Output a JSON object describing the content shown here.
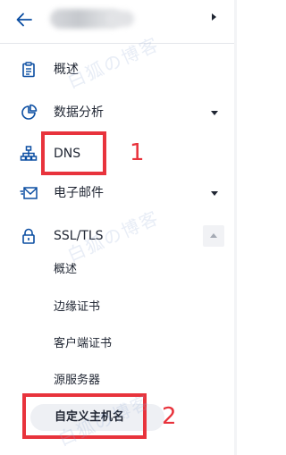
{
  "header": {
    "back_icon": "arrow-left-icon",
    "expand_icon": "caret-right-icon"
  },
  "menu": [
    {
      "label": "概述",
      "icon": "clipboard-icon"
    },
    {
      "label": "数据分析",
      "icon": "pie-chart-icon",
      "expandable": true
    },
    {
      "label": "DNS",
      "icon": "network-tree-icon"
    },
    {
      "label": "电子邮件",
      "icon": "email-forward-icon",
      "expandable": true
    },
    {
      "label": "SSL/TLS",
      "icon": "lock-icon",
      "expanded": true,
      "children": [
        {
          "label": "概述"
        },
        {
          "label": "边缘证书"
        },
        {
          "label": "客户端证书"
        },
        {
          "label": "源服务器"
        },
        {
          "label": "自定义主机名",
          "active": true
        }
      ]
    }
  ],
  "annotations": [
    {
      "number": "1",
      "target": "DNS"
    },
    {
      "number": "2",
      "target": "自定义主机名"
    }
  ],
  "watermark": "白狐の博客",
  "colors": {
    "text": "#1f2532",
    "accent_icon": "#0b4ea2",
    "annotation": "#e8333c",
    "active_bg": "#eef0f4"
  }
}
